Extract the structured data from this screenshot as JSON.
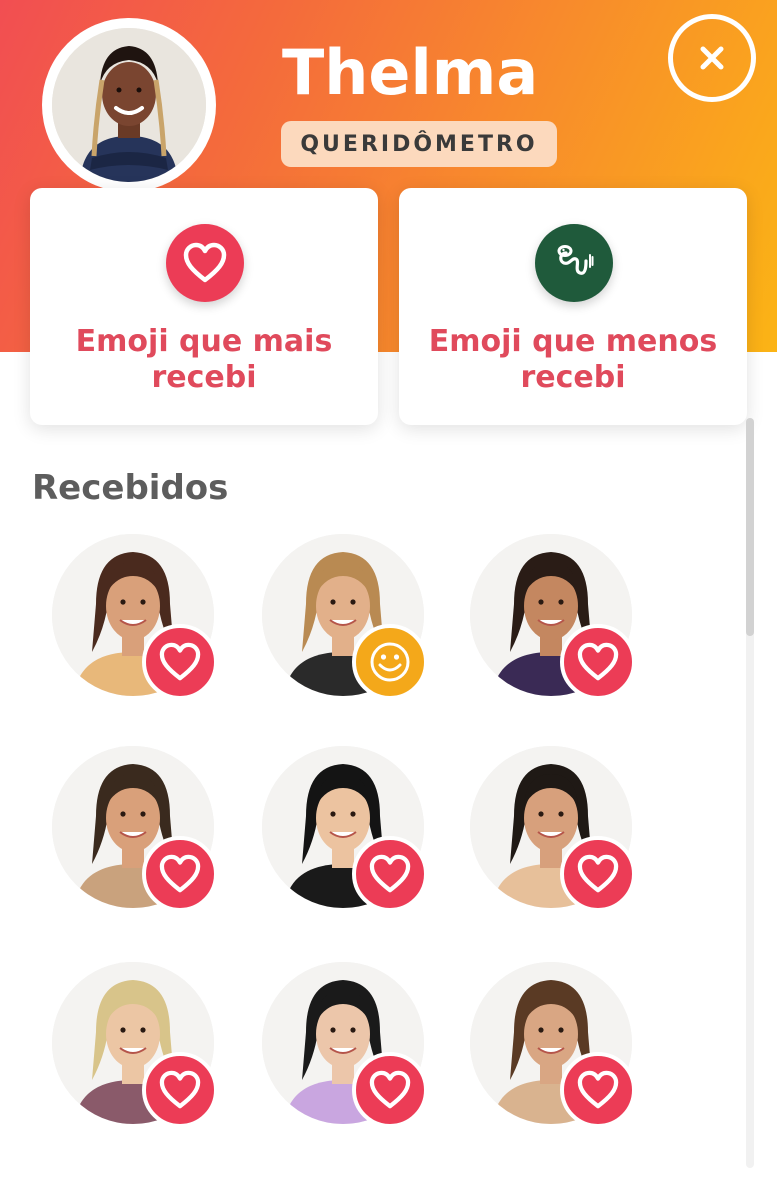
{
  "profile": {
    "name": "Thelma",
    "badge": "QUERIDÔMETRO"
  },
  "cards": [
    {
      "icon": "heart-icon",
      "label_line1": "Emoji que mais",
      "label_line2": "recebi",
      "color": "#ec3c56"
    },
    {
      "icon": "snake-icon",
      "label_line1": "Emoji que menos",
      "label_line2": "recebi",
      "color": "#1f5a3b"
    }
  ],
  "section": {
    "title": "Recebidos"
  },
  "received": [
    {
      "reaction": "heart-icon",
      "hair": "#4a2a1e",
      "skin": "#d9a07a",
      "shirt": "#e8b87a"
    },
    {
      "reaction": "smiley-icon",
      "hair": "#b98a52",
      "skin": "#e2b08a",
      "shirt": "#2a2a2a"
    },
    {
      "reaction": "heart-icon",
      "hair": "#2a1c16",
      "skin": "#c48760",
      "shirt": "#3a2a55"
    },
    {
      "reaction": "heart-icon",
      "hair": "#3a2a1e",
      "skin": "#d9a07a",
      "shirt": "#c9a27d"
    },
    {
      "reaction": "heart-icon",
      "hair": "#141414",
      "skin": "#ecc3a0",
      "shirt": "#1a1a1a"
    },
    {
      "reaction": "heart-icon",
      "hair": "#1f1915",
      "skin": "#d7a07c",
      "shirt": "#e7c09a"
    },
    {
      "reaction": "heart-icon",
      "hair": "#d8c48a",
      "skin": "#ecc6a4",
      "shirt": "#8a5a6a"
    },
    {
      "reaction": "heart-icon",
      "hair": "#1a1a1a",
      "skin": "#ecc6aa",
      "shirt": "#c9a6e0"
    },
    {
      "reaction": "heart-icon",
      "hair": "#5a3a24",
      "skin": "#d9a683",
      "shirt": "#d9b38f"
    }
  ],
  "colors": {
    "heart": "#ec3c56",
    "smiley": "#f4a81a",
    "accent_text": "#e04a5c"
  }
}
